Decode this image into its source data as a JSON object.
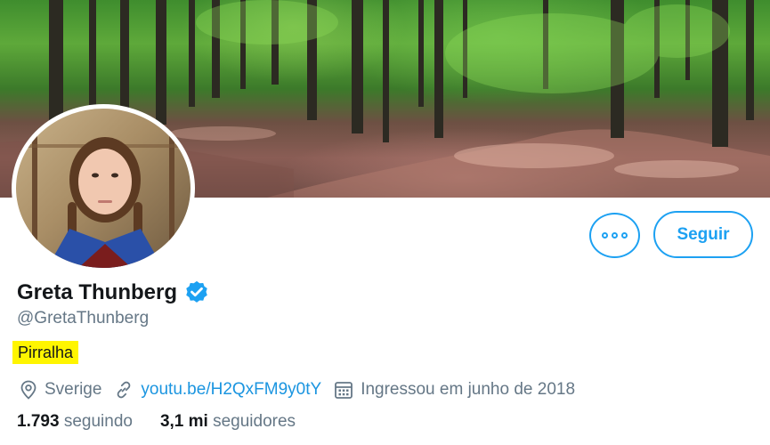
{
  "profile": {
    "display_name": "Greta Thunberg",
    "handle": "@GretaThunberg",
    "bio": "Pirralha",
    "verified": true,
    "avatar_label": "avatar",
    "banner_label": "forest-banner"
  },
  "actions": {
    "more_icon": "more-icon",
    "follow_label": "Seguir"
  },
  "meta": {
    "location": "Sverige",
    "location_icon": "location-pin-icon",
    "website": "youtu.be/H2QxFM9y0tY",
    "website_icon": "link-icon",
    "joined": "Ingressou em junho de 2018",
    "joined_icon": "calendar-icon"
  },
  "stats": {
    "following_count": "1.793",
    "following_label": "seguindo",
    "followers_count": "3,1 mi",
    "followers_label": "seguidores"
  },
  "colors": {
    "accent": "#1da1f2",
    "link": "#1b95e0",
    "muted_text": "#657786",
    "primary_text": "#14171a",
    "highlight": "#fff500"
  }
}
